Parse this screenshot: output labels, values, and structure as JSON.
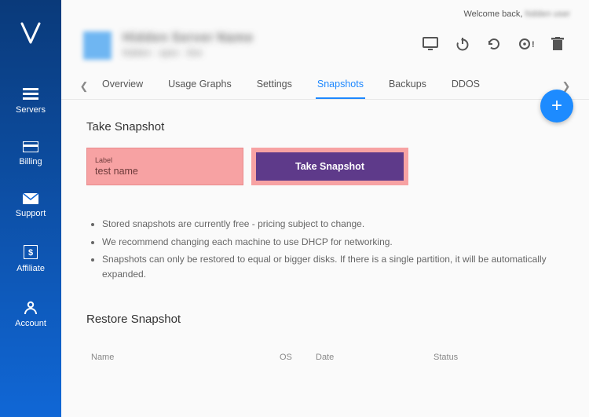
{
  "welcome": {
    "prefix": "Welcome back,",
    "name": "hidden user"
  },
  "sidebar": {
    "items": [
      {
        "label": "Servers"
      },
      {
        "label": "Billing"
      },
      {
        "label": "Support"
      },
      {
        "label": "Affiliate"
      },
      {
        "label": "Account"
      }
    ]
  },
  "server": {
    "title": "Hidden Server Name",
    "sub": "hidden · spec · line"
  },
  "tabs": [
    {
      "label": "Overview"
    },
    {
      "label": "Usage Graphs"
    },
    {
      "label": "Settings"
    },
    {
      "label": "Snapshots"
    },
    {
      "label": "Backups"
    },
    {
      "label": "DDOS"
    }
  ],
  "active_tab": "Snapshots",
  "take_snapshot": {
    "title": "Take Snapshot",
    "label_caption": "Label",
    "label_value": "test name",
    "button": "Take Snapshot"
  },
  "notes": [
    "Stored snapshots are currently free - pricing subject to change.",
    "We recommend changing each machine to use DHCP for networking.",
    "Snapshots can only be restored to equal or bigger disks. If there is a single partition, it will be automatically expanded."
  ],
  "restore": {
    "title": "Restore Snapshot",
    "columns": {
      "name": "Name",
      "os": "OS",
      "date": "Date",
      "status": "Status"
    }
  }
}
